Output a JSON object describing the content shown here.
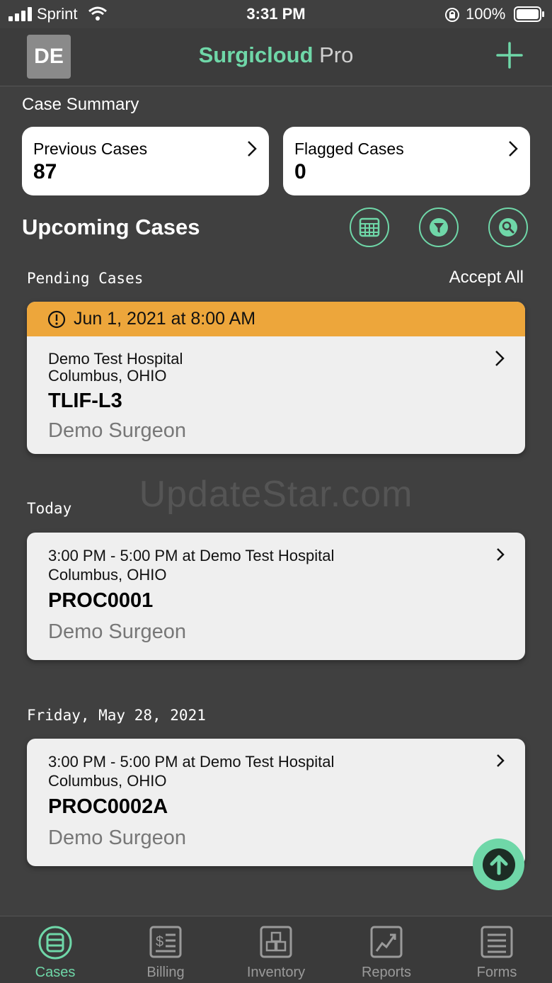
{
  "status_bar": {
    "carrier": "Sprint",
    "time": "3:31 PM",
    "battery": "100%"
  },
  "header": {
    "avatar": "DE",
    "title_brand": "Surgicloud",
    "title_suffix": " Pro",
    "add_icon": "plus-icon"
  },
  "summary": {
    "label": "Case Summary",
    "previous": {
      "label": "Previous Cases",
      "value": "87"
    },
    "flagged": {
      "label": "Flagged Cases",
      "value": "0"
    }
  },
  "upcoming": {
    "title": "Upcoming Cases",
    "buttons": [
      "calendar-icon",
      "filter-icon",
      "search-icon"
    ]
  },
  "pending": {
    "label": "Pending Cases",
    "accept_all": "Accept All",
    "case": {
      "date": "Jun 1, 2021 at 8:00 AM",
      "hospital": "Demo Test Hospital",
      "location": "Columbus, OHIO",
      "code": "TLIF-L3",
      "surgeon": "Demo Surgeon"
    }
  },
  "watermark": "UpdateStar.com",
  "today": {
    "label": "Today",
    "case": {
      "time": "3:00 PM - 5:00 PM at Demo Test Hospital",
      "location": "Columbus, OHIO",
      "code": "PROC0001",
      "surgeon": "Demo Surgeon"
    }
  },
  "friday": {
    "label": "Friday, May 28, 2021",
    "case": {
      "time": "3:00 PM - 5:00 PM at Demo Test Hospital",
      "location": "Columbus, OHIO",
      "code": "PROC0002A",
      "surgeon": "Demo Surgeon"
    }
  },
  "tabs": [
    {
      "label": "Cases",
      "icon": "cases-icon",
      "active": true
    },
    {
      "label": "Billing",
      "icon": "billing-icon"
    },
    {
      "label": "Inventory",
      "icon": "inventory-icon"
    },
    {
      "label": "Reports",
      "icon": "reports-icon"
    },
    {
      "label": "Forms",
      "icon": "forms-icon"
    }
  ],
  "colors": {
    "accent": "#6fd7a8",
    "pending": "#eda63b",
    "background": "#404040"
  }
}
